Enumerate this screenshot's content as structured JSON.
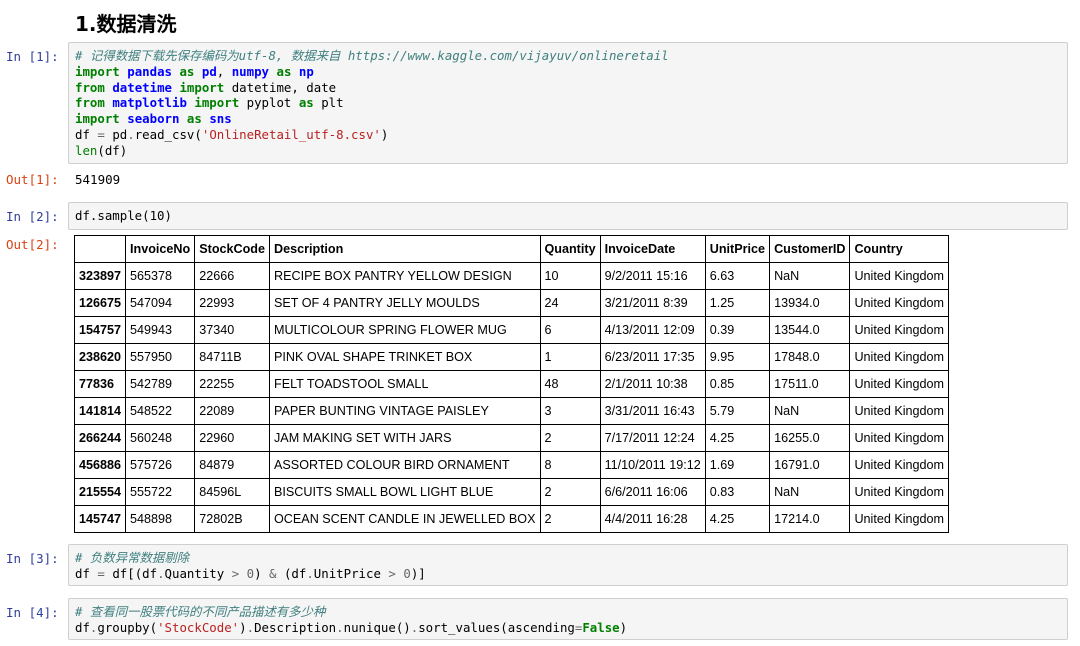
{
  "heading": "1.数据清洗",
  "cells": {
    "c1": {
      "prompt": "In [1]:",
      "comment": "# 记得数据下载先保存编码为utf-8, 数据来自 https://www.kaggle.com/vijayuv/onlineretail",
      "out_prompt": "Out[1]:",
      "output": "541909"
    },
    "c2": {
      "prompt": "In [2]:",
      "code": "df.sample(10)",
      "out_prompt": "Out[2]:"
    },
    "c3": {
      "prompt": "In [3]:",
      "comment": "# 负数异常数据剔除"
    },
    "c4": {
      "prompt": "In [4]:",
      "comment": "# 查看同一股票代码的不同产品描述有多少种"
    }
  },
  "table": {
    "columns": [
      "",
      "InvoiceNo",
      "StockCode",
      "Description",
      "Quantity",
      "InvoiceDate",
      "UnitPrice",
      "CustomerID",
      "Country"
    ],
    "rows": [
      [
        "323897",
        "565378",
        "22666",
        "RECIPE BOX PANTRY YELLOW DESIGN",
        "10",
        "9/2/2011 15:16",
        "6.63",
        "NaN",
        "United Kingdom"
      ],
      [
        "126675",
        "547094",
        "22993",
        "SET OF 4 PANTRY JELLY MOULDS",
        "24",
        "3/21/2011 8:39",
        "1.25",
        "13934.0",
        "United Kingdom"
      ],
      [
        "154757",
        "549943",
        "37340",
        "MULTICOLOUR SPRING FLOWER MUG",
        "6",
        "4/13/2011 12:09",
        "0.39",
        "13544.0",
        "United Kingdom"
      ],
      [
        "238620",
        "557950",
        "84711B",
        "PINK OVAL SHAPE TRINKET BOX",
        "1",
        "6/23/2011 17:35",
        "9.95",
        "17848.0",
        "United Kingdom"
      ],
      [
        "77836",
        "542789",
        "22255",
        "FELT TOADSTOOL SMALL",
        "48",
        "2/1/2011 10:38",
        "0.85",
        "17511.0",
        "United Kingdom"
      ],
      [
        "141814",
        "548522",
        "22089",
        "PAPER BUNTING VINTAGE PAISLEY",
        "3",
        "3/31/2011 16:43",
        "5.79",
        "NaN",
        "United Kingdom"
      ],
      [
        "266244",
        "560248",
        "22960",
        "JAM MAKING SET WITH JARS",
        "2",
        "7/17/2011 12:24",
        "4.25",
        "16255.0",
        "United Kingdom"
      ],
      [
        "456886",
        "575726",
        "84879",
        "ASSORTED COLOUR BIRD ORNAMENT",
        "8",
        "11/10/2011 19:12",
        "1.69",
        "16791.0",
        "United Kingdom"
      ],
      [
        "215554",
        "555722",
        "84596L",
        "BISCUITS SMALL BOWL LIGHT BLUE",
        "2",
        "6/6/2011 16:06",
        "0.83",
        "NaN",
        "United Kingdom"
      ],
      [
        "145747",
        "548898",
        "72802B",
        "OCEAN SCENT CANDLE IN JEWELLED BOX",
        "2",
        "4/4/2011 16:28",
        "4.25",
        "17214.0",
        "United Kingdom"
      ]
    ]
  }
}
